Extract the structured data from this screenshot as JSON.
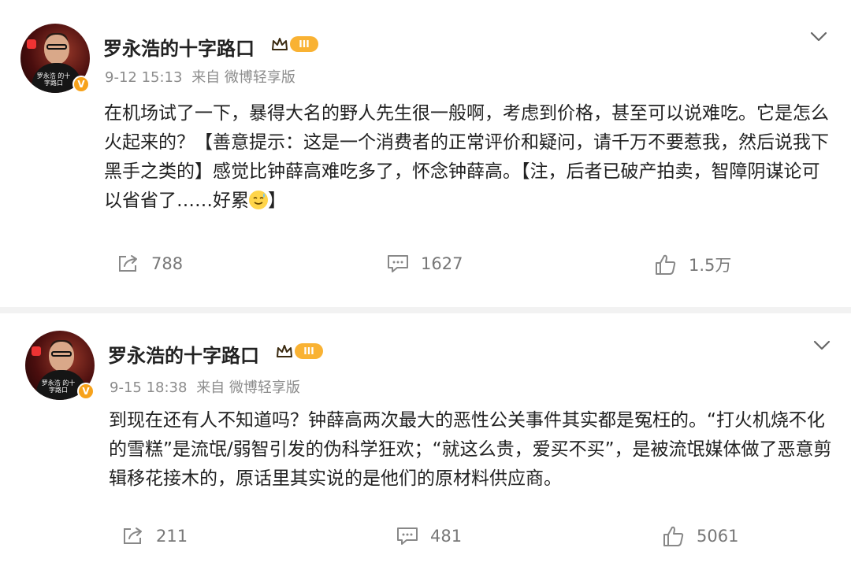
{
  "posts": [
    {
      "author": "罗永浩的十字路口",
      "level_badge": "III",
      "verified_mark": "V",
      "avatar_caption": "罗永浩 的十字路口",
      "time": "9-12 15:13",
      "source": "来自 微博轻享版",
      "text": "在机场试了一下，暴得大名的野人先生很一般啊，考虑到价格，甚至可以说难吃。它是怎么火起来的？【善意提示：这是一个消费者的正常评价和疑问，请千万不要惹我，然后说我下黑手之类的】感觉比钟薛高难吃多了，怀念钟薛高。【注，后者已破产拍卖，智障阴谋论可以省省了……好累",
      "text_end": "】",
      "emoji": "sweat-smile-emoji",
      "reposts": "788",
      "comments": "1627",
      "likes": "1.5万"
    },
    {
      "author": "罗永浩的十字路口",
      "level_badge": "III",
      "verified_mark": "V",
      "avatar_caption": "罗永浩 的十字路口",
      "time": "9-15 18:38",
      "source": "来自 微博轻享版",
      "text": "到现在还有人不知道吗？钟薛高两次最大的恶性公关事件其实都是冤枉的。“打火机烧不化的雪糕”是流氓/弱智引发的伪科学狂欢；“就这么贵，爱买不买”，是被流氓媒体做了恶意剪辑移花接木的，原话里其实说的是他们的原材料供应商。",
      "reposts": "211",
      "comments": "481",
      "likes": "5061"
    }
  ],
  "colors": {
    "badge_orange": "#f9b233",
    "verified_orange": "#f7a21b",
    "meta_gray": "#8c8c8c",
    "text_dark": "#222222"
  },
  "icons": [
    "repost-icon",
    "comment-icon",
    "like-icon",
    "chevron-down-icon",
    "crown-icon"
  ]
}
